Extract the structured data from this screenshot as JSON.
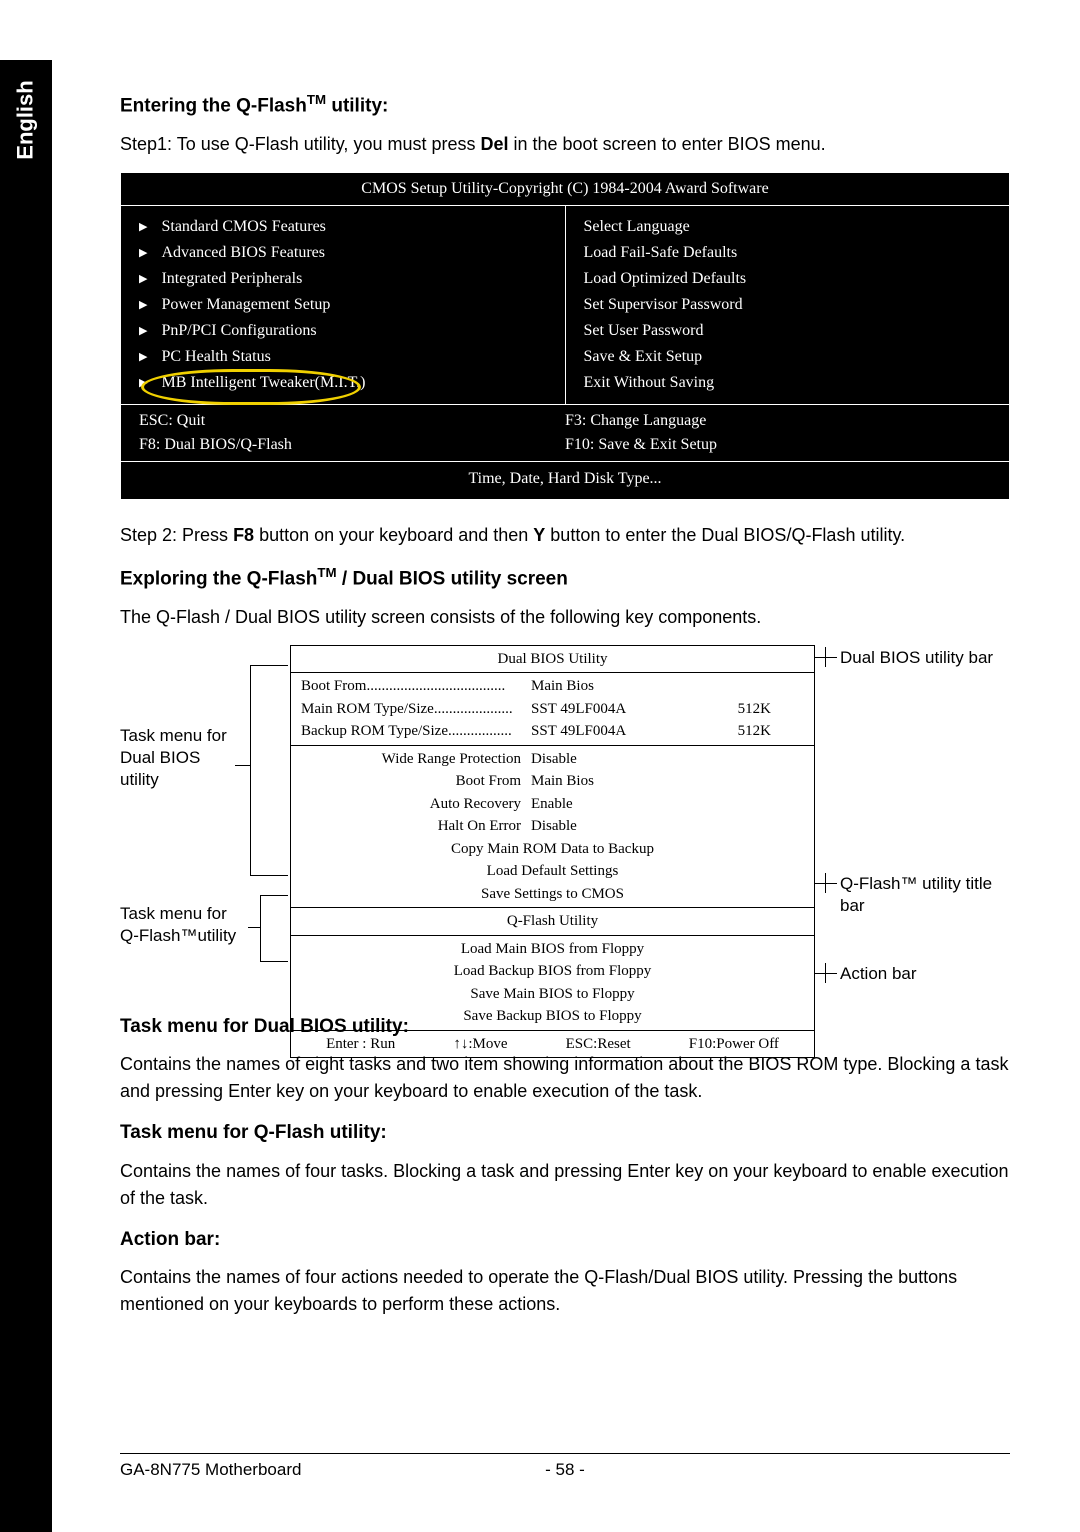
{
  "sidebar_label": "English",
  "section1": {
    "heading_pre": "Entering the Q-Flash",
    "heading_tm": "TM",
    "heading_post": " utility:",
    "step1_a": "Step1: To use Q-Flash utility, you must press ",
    "step1_key": "Del",
    "step1_b": " in the boot screen to enter BIOS menu."
  },
  "cmos": {
    "title": "CMOS Setup Utility-Copyright (C) 1984-2004 Award Software",
    "left": [
      "Standard CMOS Features",
      "Advanced BIOS Features",
      "Integrated Peripherals",
      "Power Management Setup",
      "PnP/PCI Configurations",
      "PC Health Status",
      "MB Intelligent Tweaker(M.I.T.)"
    ],
    "right": [
      "Select Language",
      "Load Fail-Safe Defaults",
      "Load Optimized Defaults",
      "Set Supervisor Password",
      "Set User Password",
      "Save & Exit Setup",
      "Exit Without Saving"
    ],
    "keys": {
      "esc": "ESC: Quit",
      "f8": "F8: Dual BIOS/Q-Flash",
      "f3": "F3: Change Language",
      "f10": "F10: Save & Exit Setup"
    },
    "footer": "Time, Date, Hard Disk Type..."
  },
  "step2_a": "Step 2: Press ",
  "step2_k1": "F8",
  "step2_b": " button on your keyboard and then ",
  "step2_k2": "Y",
  "step2_c": " button to enter the Dual BIOS/Q-Flash utility.",
  "section2": {
    "heading_pre": "Exploring the Q-Flash",
    "heading_tm": "TM",
    "heading_post": " / Dual BIOS utility screen",
    "intro": "The Q-Flash / Dual BIOS utility screen consists of the following key components."
  },
  "dual": {
    "title": "Dual BIOS Utility",
    "rows": [
      {
        "label": "Boot From",
        "v1": "Main Bios",
        "v2": ""
      },
      {
        "label": "Main ROM Type/Size",
        "v1": "SST 49LF004A",
        "v2": "512K"
      },
      {
        "label": "Backup ROM Type/Size",
        "v1": "SST 49LF004A",
        "v2": "512K"
      }
    ],
    "opts": [
      {
        "label": "Wide Range Protection",
        "val": "Disable"
      },
      {
        "label": "Boot From",
        "val": "Main Bios"
      },
      {
        "label": "Auto Recovery",
        "val": "Enable"
      },
      {
        "label": "Halt On Error",
        "val": "Disable"
      }
    ],
    "center_items": [
      "Copy Main ROM Data to Backup",
      "Load Default Settings",
      "Save Settings to CMOS"
    ],
    "qflash_title": "Q-Flash Utility",
    "qflash_items": [
      "Load Main BIOS from Floppy",
      "Load Backup BIOS from Floppy",
      "Save Main BIOS to Floppy",
      "Save Backup BIOS to Floppy"
    ],
    "actions": [
      "Enter : Run",
      "↑↓:Move",
      "ESC:Reset",
      "F10:Power Off"
    ]
  },
  "callouts": {
    "dual_bar": "Dual BIOS utility bar",
    "task_dual_l1": "Task menu for",
    "task_dual_l2": "Dual BIOS",
    "task_dual_l3": "utility",
    "qflash_bar_l1": "Q-Flash™ utility title",
    "qflash_bar_l2": "bar",
    "task_qf_l1": "Task menu for",
    "task_qf_l2": "Q-Flash™utility",
    "action_bar": "Action bar"
  },
  "section3": {
    "h1": "Task menu for Dual BIOS utility:",
    "p1": "Contains the names of eight tasks and two item showing information about the BIOS ROM type. Blocking a task and pressing Enter key on your keyboard to enable execution of the task.",
    "h2": "Task menu for Q-Flash utility:",
    "p2": "Contains the names of four tasks. Blocking a task and pressing Enter key on your keyboard to enable execution of the task.",
    "h3": "Action bar:",
    "p3": "Contains the names of four actions needed to operate the Q-Flash/Dual BIOS utility. Pressing the buttons mentioned on your keyboards to perform these actions."
  },
  "footer": {
    "left": "GA-8N775 Motherboard",
    "center": "- 58 -"
  }
}
